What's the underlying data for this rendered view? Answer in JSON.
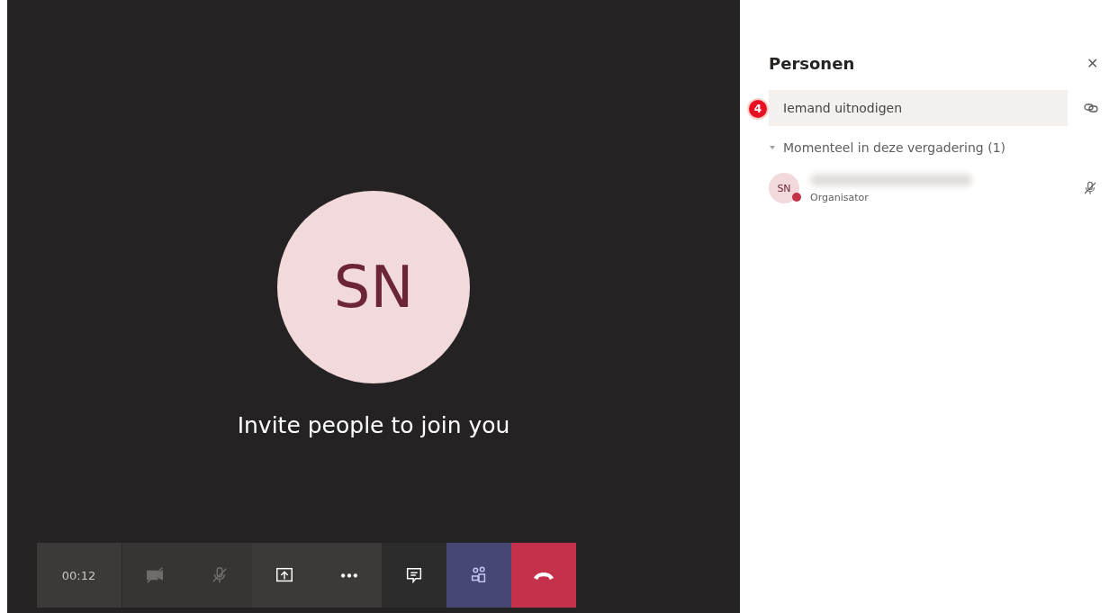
{
  "stage": {
    "avatar_initials": "SN",
    "message": "Invite people to join you"
  },
  "toolbar": {
    "timer": "00:12",
    "buttons": [
      {
        "kind": "camera",
        "selected": false,
        "disabled": true
      },
      {
        "kind": "mic",
        "selected": false,
        "disabled": true
      },
      {
        "kind": "share",
        "selected": false,
        "disabled": false
      },
      {
        "kind": "more",
        "selected": false,
        "disabled": false
      },
      {
        "kind": "chat",
        "selected": false,
        "disabled": false
      },
      {
        "kind": "people",
        "selected": true,
        "disabled": false
      },
      {
        "kind": "hangup"
      }
    ]
  },
  "panel": {
    "title": "Personen",
    "close_glyph": "✕",
    "invite": {
      "placeholder": "Iemand uitnodigen",
      "step_badge": "4"
    },
    "section": {
      "label": "Momenteel in deze vergadering (1)",
      "expanded": true
    },
    "participants": [
      {
        "initials": "SN",
        "role": "Organisator",
        "muted": true,
        "color": "#c4314b"
      }
    ]
  }
}
